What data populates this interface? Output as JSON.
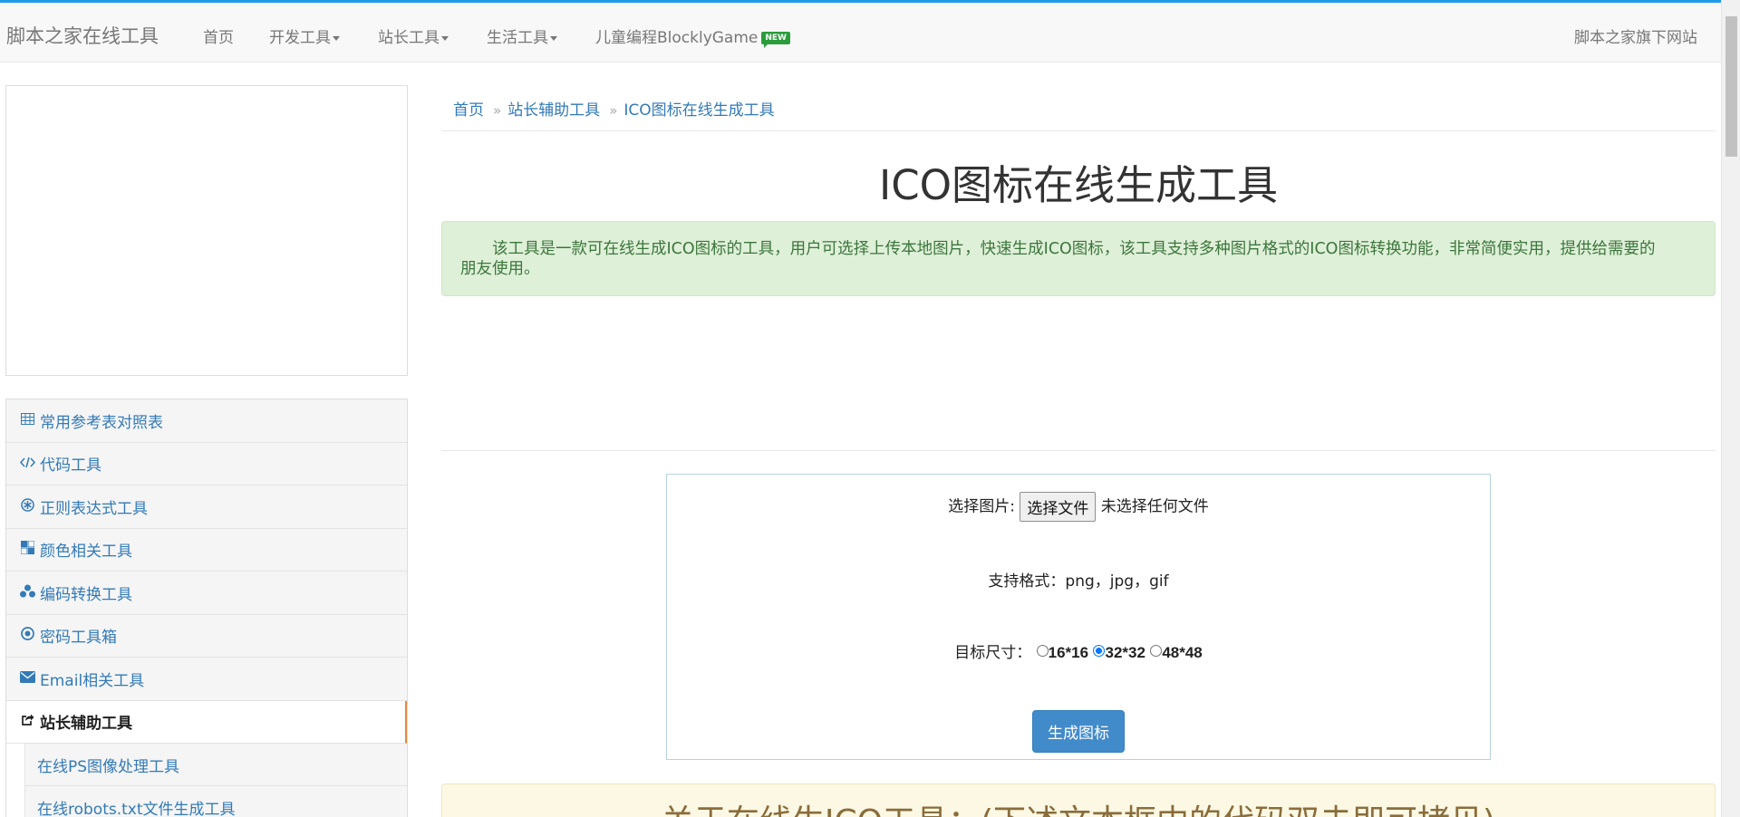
{
  "navbar": {
    "brand": "脚本之家在线工具",
    "items": [
      {
        "label": "首页"
      },
      {
        "label": "开发工具"
      },
      {
        "label": "站长工具"
      },
      {
        "label": "生活工具"
      },
      {
        "label": "儿童编程BlocklyGame",
        "badge": "NEW"
      }
    ],
    "right": "脚本之家旗下网站"
  },
  "sidebar": {
    "items": [
      {
        "label": "常用参考表对照表",
        "icon": "table-icon"
      },
      {
        "label": "代码工具",
        "icon": "code-icon"
      },
      {
        "label": "正则表达式工具",
        "icon": "asterisk-icon"
      },
      {
        "label": "颜色相关工具",
        "icon": "color-icon"
      },
      {
        "label": "编码转换工具",
        "icon": "cubes-icon"
      },
      {
        "label": "密码工具箱",
        "icon": "target-icon"
      },
      {
        "label": "Email相关工具",
        "icon": "envelope-icon"
      },
      {
        "label": "站长辅助工具",
        "icon": "share-icon",
        "active": true
      }
    ],
    "subitems": [
      {
        "label": "在线PS图像处理工具"
      },
      {
        "label": "在线robots.txt文件生成工具"
      }
    ]
  },
  "breadcrumb": {
    "items": [
      "首页",
      "站长辅助工具",
      "ICO图标在线生成工具"
    ],
    "separator": "»"
  },
  "main": {
    "title": "ICO图标在线生成工具",
    "intro": "该工具是一款可在线生成ICO图标的工具，用户可选择上传本地图片，快速生成ICO图标，该工具支持多种图片格式的ICO图标转换功能，非常简便实用，提供给需要的朋友使用。"
  },
  "tool": {
    "choose_label": "选择图片:",
    "file_button": "选择文件",
    "file_status": "未选择任何文件",
    "formats_label": "支持格式：png，jpg，gif",
    "size_label": "目标尺寸：",
    "sizes": [
      {
        "label": "16*16",
        "checked": false
      },
      {
        "label": "32*32",
        "checked": true
      },
      {
        "label": "48*48",
        "checked": false
      }
    ],
    "generate_button": "生成图标"
  },
  "about": {
    "title": "关于在线生ICO工具：(下述文本框中的代码双击即可拷贝)"
  },
  "colors": {
    "accent": "#1e9be6",
    "link": "#337ab7",
    "success_bg": "#dff0d8",
    "button_primary": "#428bca",
    "active_marker": "#e28a3b"
  }
}
